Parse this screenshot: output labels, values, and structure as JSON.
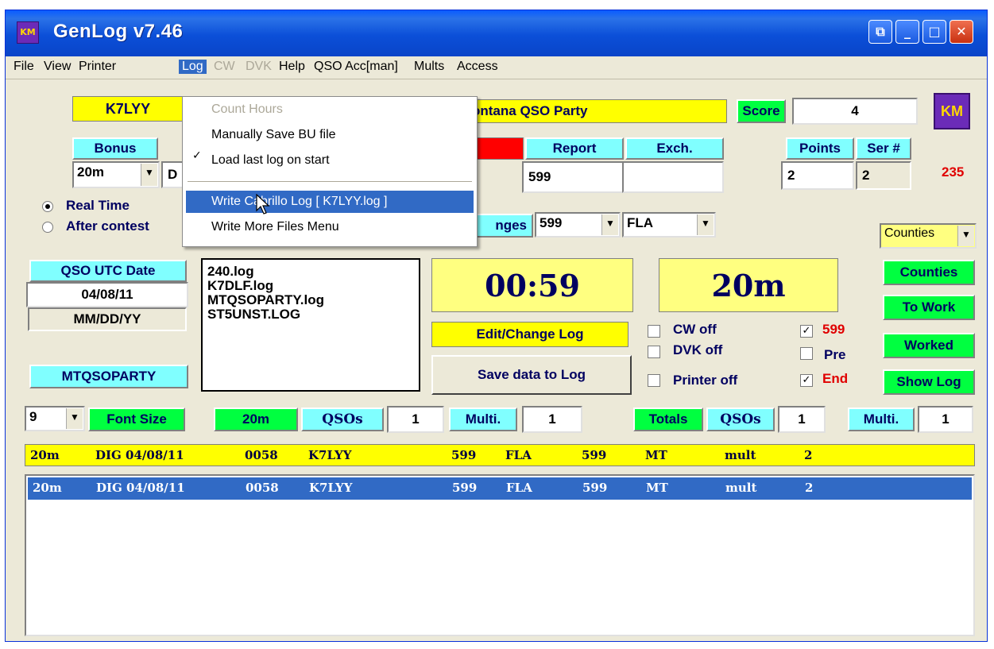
{
  "window": {
    "title": "GenLog   v7.46",
    "app_icon": "KM",
    "buttons": {
      "extra": "⧉",
      "minimize": "_",
      "maximize": "□",
      "close": "✕"
    }
  },
  "menu": {
    "items": [
      "File",
      "View",
      "Printer",
      "Log",
      "CW",
      "DVK",
      "Help",
      "QSO Acc[man]",
      "Mults",
      "Access"
    ]
  },
  "log_menu": {
    "items": [
      "Count Hours",
      "Manually Save BU file",
      "Load last log on start",
      "Write Cabrillo Log [ K7LYY.log ]",
      "Write More Files Menu"
    ]
  },
  "top": {
    "callsign": "K7LYY",
    "contest": "ontana QSO Party",
    "score_label": "Score",
    "score_value": "4",
    "logo": "KM"
  },
  "headers": {
    "bonus": "Bonus",
    "report": "Report",
    "exch": "Exch.",
    "points": "Points",
    "ser": "Ser #",
    "serial_count": "235"
  },
  "fields": {
    "band": "20m",
    "mode_partial": "D",
    "report": "599",
    "exch": "",
    "points": "2",
    "ser": "2"
  },
  "timing": {
    "real_time": "Real Time",
    "after_contest": "After contest"
  },
  "changes": {
    "label": "nges",
    "rst": "599",
    "exch": "FLA"
  },
  "right_buttons": {
    "counties_combo": "Counties",
    "counties": "Counties",
    "to_work": "To Work",
    "worked": "Worked",
    "show_log": "Show Log"
  },
  "date": {
    "label": "QSO UTC Date",
    "value": "04/08/11",
    "format": "MM/DD/YY",
    "logname": "MTQSOPARTY"
  },
  "files": [
    "240.log",
    "K7DLF.log",
    "MTQSOPARTY.log",
    "ST5UNST.LOG"
  ],
  "clock": "00:59",
  "band_display": "20m",
  "edit_change": "Edit/Change Log",
  "save_data": "Save data to Log",
  "checks": {
    "cw_off": "CW off",
    "dvk_off": "DVK off",
    "printer_off": "Printer off",
    "r599": "599",
    "pre": "Pre",
    "end": "End"
  },
  "stats": {
    "font_size_value": "9",
    "font_size_label": "Font Size",
    "band": "20m",
    "qsos_label": "QSOs",
    "qsos": "1",
    "multi_label": "Multi.",
    "multi": "1",
    "totals_label": "Totals",
    "total_qsos_label": "QSOs",
    "total_qsos": "1",
    "total_multi_label": "Multi.",
    "total_multi": "1"
  },
  "log_entry": {
    "band": "20m",
    "mode_date": "DIG 04/08/11",
    "time": "0058",
    "call": "K7LYY",
    "sent": "599",
    "exch": "FLA",
    "rcvd": "599",
    "state": "MT",
    "mult": "mult",
    "pts": "2"
  },
  "colors": {
    "accent": "#316ac5",
    "title": "#0a44c8",
    "yellow": "#ffff00",
    "cyan": "#80ffff",
    "green": "#00ff40",
    "red": "#e00000"
  }
}
